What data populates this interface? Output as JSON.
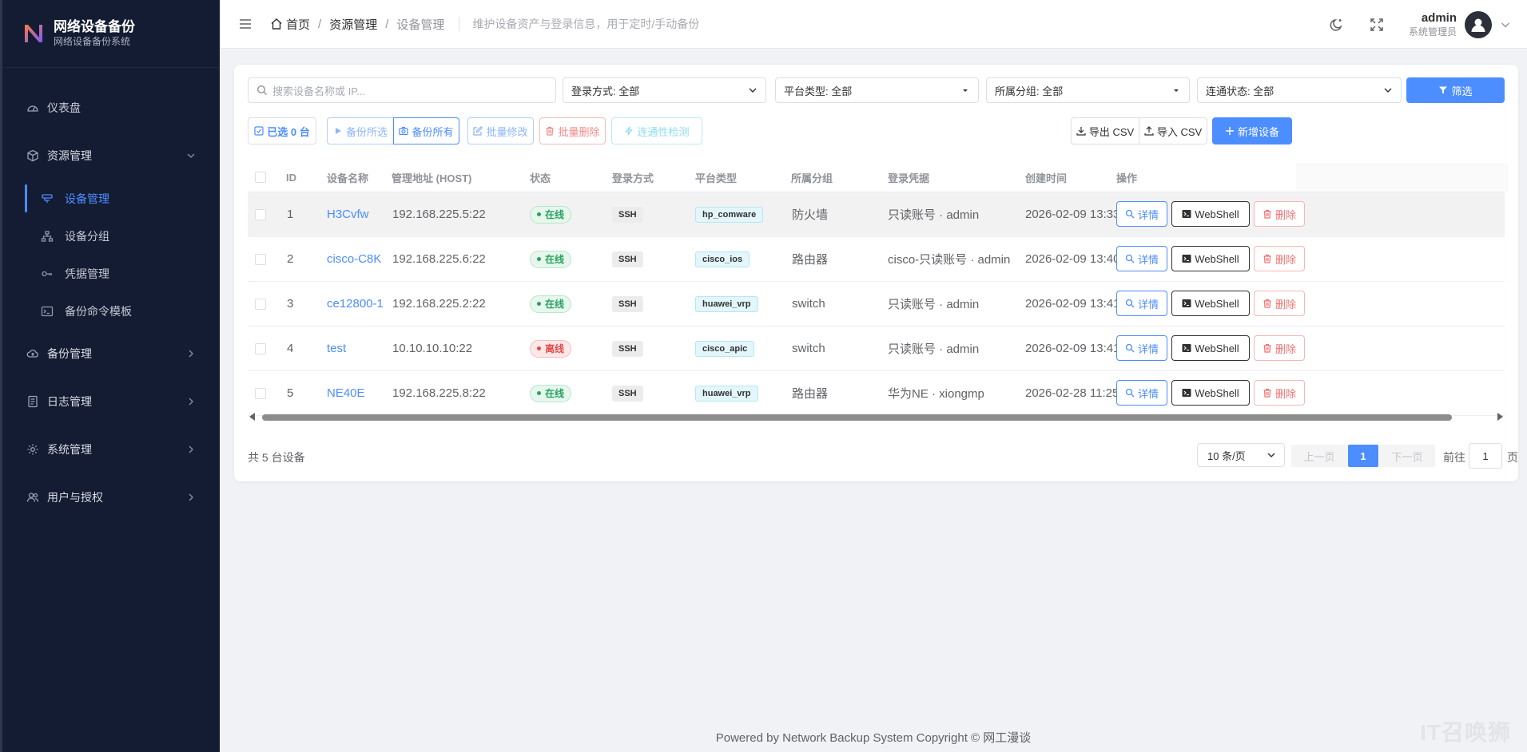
{
  "brand": {
    "title": "网络设备备份",
    "subtitle": "网络设备备份系统"
  },
  "sidebar": {
    "dashboard": "仪表盘",
    "resource": "资源管理",
    "resource_items": [
      "设备管理",
      "设备分组",
      "凭据管理",
      "备份命令模板"
    ],
    "backup": "备份管理",
    "logs": "日志管理",
    "system": "系统管理",
    "users": "用户与授权"
  },
  "header": {
    "crumb_home": "首页",
    "crumb_resource": "资源管理",
    "crumb_current": "设备管理",
    "description": "维护设备资产与登录信息，用于定时/手动备份",
    "user_name": "admin",
    "user_role": "系统管理员"
  },
  "filters": {
    "search_placeholder": "搜索设备名称或 IP...",
    "login_method": "登录方式: 全部",
    "platform": "平台类型: 全部",
    "group": "所属分组: 全部",
    "connectivity": "连通状态: 全部",
    "filter_button": "筛选"
  },
  "actions": {
    "selected": "已选 0 台",
    "backup_selected": "备份所选",
    "backup_all": "备份所有",
    "batch_edit": "批量修改",
    "batch_delete": "批量删除",
    "connectivity_check": "连通性检测",
    "export_csv": "导出 CSV",
    "import_csv": "导入 CSV",
    "add_device": "新增设备"
  },
  "table": {
    "columns": [
      "ID",
      "设备名称",
      "管理地址 (HOST)",
      "状态",
      "登录方式",
      "平台类型",
      "所属分组",
      "登录凭据",
      "创建时间",
      "操作"
    ],
    "rows": [
      {
        "id": "1",
        "name": "H3Cvfw",
        "host": "192.168.225.5:22",
        "status": "在线",
        "login": "SSH",
        "platform": "hp_comware",
        "group": "防火墙",
        "cred": "只读账号 · admin",
        "created": "2026-02-09 13:33"
      },
      {
        "id": "2",
        "name": "cisco-C8K",
        "host": "192.168.225.6:22",
        "status": "在线",
        "login": "SSH",
        "platform": "cisco_ios",
        "group": "路由器",
        "cred": "cisco-只读账号 · admin",
        "created": "2026-02-09 13:40"
      },
      {
        "id": "3",
        "name": "ce12800-1",
        "host": "192.168.225.2:22",
        "status": "在线",
        "login": "SSH",
        "platform": "huawei_vrp",
        "group": "switch",
        "cred": "只读账号 · admin",
        "created": "2026-02-09 13:41"
      },
      {
        "id": "4",
        "name": "test",
        "host": "10.10.10.10:22",
        "status": "离线",
        "login": "SSH",
        "platform": "cisco_apic",
        "group": "switch",
        "cred": "只读账号 · admin",
        "created": "2026-02-09 13:41"
      },
      {
        "id": "5",
        "name": "NE40E",
        "host": "192.168.225.8:22",
        "status": "在线",
        "login": "SSH",
        "platform": "huawei_vrp",
        "group": "路由器",
        "cred": "华为NE · xiongmp",
        "created": "2026-02-28 11:25"
      }
    ],
    "op_detail": "详情",
    "op_webshell": "WebShell",
    "op_delete": "删除"
  },
  "pagination": {
    "total": "共 5 台设备",
    "page_size": "10 条/页",
    "prev": "上一页",
    "current": "1",
    "next": "下一页",
    "goto": "前往",
    "goto_value": "1",
    "unit": "页"
  },
  "footer": {
    "copyright": "Powered by Network Backup System Copyright © 网工漫谈",
    "watermark": "IT召唤狮"
  },
  "colors": {
    "primary": "#4c8dff",
    "sidebar_bg": "#141c33",
    "online": "#2ba360",
    "offline": "#e24b4b"
  }
}
